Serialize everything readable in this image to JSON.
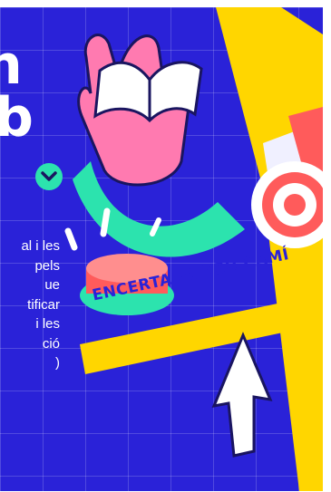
{
  "hero": {
    "heading_line_1": "n",
    "heading_line_2": "b",
    "body_lines": [
      "al i les",
      "pels",
      "ue",
      "tificar",
      "i les",
      "ció",
      ")"
    ],
    "banner_text": "ENCERTA EL TEU CAMÍ",
    "scroll_icon": "chevron-down-icon"
  },
  "colors": {
    "background": "#2a22d8",
    "accent_green": "#2ce3ae",
    "accent_yellow": "#ffd600",
    "accent_pink": "#f06fb0",
    "accent_red": "#ff5b5b"
  }
}
